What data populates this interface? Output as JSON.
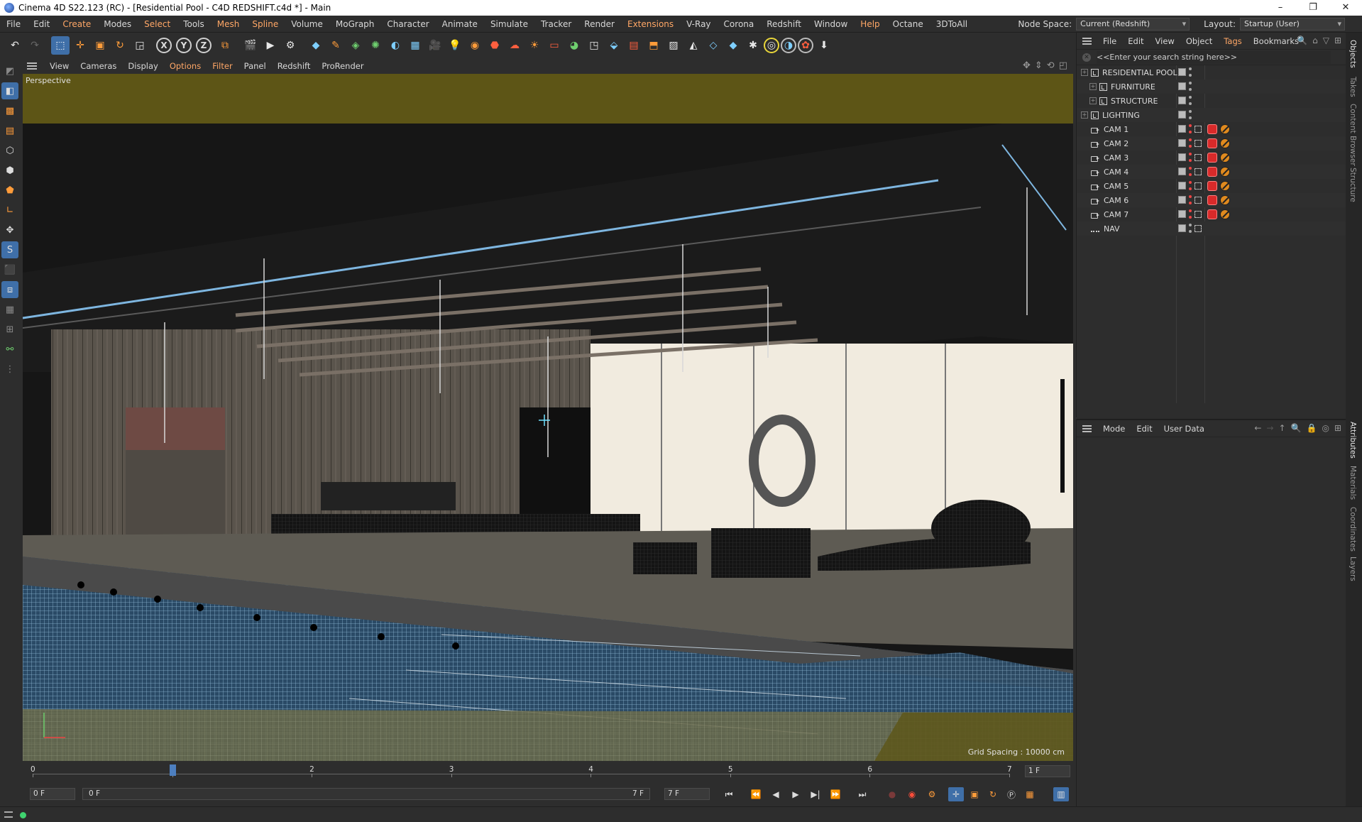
{
  "window": {
    "title": "Cinema 4D S22.123 (RC) - [Residential Pool - C4D REDSHIFT.c4d *] - Main",
    "controls": [
      "–",
      "❐",
      "✕"
    ]
  },
  "menubar": {
    "items": [
      {
        "label": "File",
        "hl": false
      },
      {
        "label": "Edit",
        "hl": false
      },
      {
        "label": "Create",
        "hl": true
      },
      {
        "label": "Modes",
        "hl": false
      },
      {
        "label": "Select",
        "hl": true
      },
      {
        "label": "Tools",
        "hl": false
      },
      {
        "label": "Mesh",
        "hl": true
      },
      {
        "label": "Spline",
        "hl": true
      },
      {
        "label": "Volume",
        "hl": false
      },
      {
        "label": "MoGraph",
        "hl": false
      },
      {
        "label": "Character",
        "hl": false
      },
      {
        "label": "Animate",
        "hl": false
      },
      {
        "label": "Simulate",
        "hl": false
      },
      {
        "label": "Tracker",
        "hl": false
      },
      {
        "label": "Render",
        "hl": false
      },
      {
        "label": "Extensions",
        "hl": true
      },
      {
        "label": "V-Ray",
        "hl": false
      },
      {
        "label": "Corona",
        "hl": false
      },
      {
        "label": "Redshift",
        "hl": false
      },
      {
        "label": "Window",
        "hl": false
      },
      {
        "label": "Help",
        "hl": true
      },
      {
        "label": "Octane",
        "hl": false
      },
      {
        "label": "3DToAll",
        "hl": false
      }
    ],
    "node_space_label": "Node Space:",
    "node_space_value": "Current (Redshift)",
    "layout_label": "Layout:",
    "layout_value": "Startup (User)"
  },
  "viewport_menu": {
    "items": [
      {
        "label": "View",
        "hl": false
      },
      {
        "label": "Cameras",
        "hl": false
      },
      {
        "label": "Display",
        "hl": false
      },
      {
        "label": "Options",
        "hl": true
      },
      {
        "label": "Filter",
        "hl": true
      },
      {
        "label": "Panel",
        "hl": false
      },
      {
        "label": "Redshift",
        "hl": false
      },
      {
        "label": "ProRender",
        "hl": false
      }
    ]
  },
  "viewport": {
    "label": "Perspective",
    "grid_spacing": "Grid Spacing : 10000 cm"
  },
  "timeline": {
    "ticks": [
      "0",
      "1",
      "2",
      "3",
      "4",
      "5",
      "6",
      "7"
    ],
    "current_frame": 1,
    "end_field": "1 F"
  },
  "transport": {
    "start_field": "0 F",
    "range_start": "0 F",
    "range_end": "7 F",
    "end_field": "7 F"
  },
  "object_manager": {
    "menu": [
      {
        "label": "File",
        "hl": false
      },
      {
        "label": "Edit",
        "hl": false
      },
      {
        "label": "View",
        "hl": false
      },
      {
        "label": "Object",
        "hl": false
      },
      {
        "label": "Tags",
        "hl": true
      },
      {
        "label": "Bookmarks",
        "hl": false
      }
    ],
    "search_placeholder": "<<Enter your search string here>>",
    "objects": [
      {
        "name": "RESIDENTIAL POOL",
        "type": "layer",
        "indent": 0,
        "expand": "+",
        "tags": false
      },
      {
        "name": "FURNITURE",
        "type": "layer",
        "indent": 1,
        "expand": "+",
        "tags": false
      },
      {
        "name": "STRUCTURE",
        "type": "layer",
        "indent": 1,
        "expand": "+",
        "tags": false
      },
      {
        "name": "LIGHTING",
        "type": "layer",
        "indent": 0,
        "expand": "+",
        "tags": false
      },
      {
        "name": "CAM 1",
        "type": "camera",
        "indent": 0,
        "expand": "",
        "tags": true
      },
      {
        "name": "CAM 2",
        "type": "camera",
        "indent": 0,
        "expand": "",
        "tags": true
      },
      {
        "name": "CAM 3",
        "type": "camera",
        "indent": 0,
        "expand": "",
        "tags": true
      },
      {
        "name": "CAM 4",
        "type": "camera",
        "indent": 0,
        "expand": "",
        "tags": true
      },
      {
        "name": "CAM 5",
        "type": "camera",
        "indent": 0,
        "expand": "",
        "tags": true
      },
      {
        "name": "CAM 6",
        "type": "camera",
        "indent": 0,
        "expand": "",
        "tags": true
      },
      {
        "name": "CAM 7",
        "type": "camera",
        "indent": 0,
        "expand": "",
        "tags": true
      },
      {
        "name": "NAV",
        "type": "null",
        "indent": 0,
        "expand": "",
        "tags": false
      }
    ]
  },
  "attribute_manager": {
    "menu": [
      {
        "label": "Mode",
        "hl": false
      },
      {
        "label": "Edit",
        "hl": false
      },
      {
        "label": "User Data",
        "hl": false
      }
    ]
  },
  "right_tabs": {
    "top": [
      "Objects",
      "Takes",
      "Content Browser",
      "Structure"
    ],
    "bottom": [
      "Attributes",
      "Materials",
      "Coordinates",
      "Layers"
    ]
  },
  "colors": {
    "accent_blue": "#3f6fa8",
    "highlight_orange": "#ffa766",
    "status_green": "#3fd36f",
    "tag_red": "#d82a2a",
    "tag_orange": "#e08a1e"
  }
}
